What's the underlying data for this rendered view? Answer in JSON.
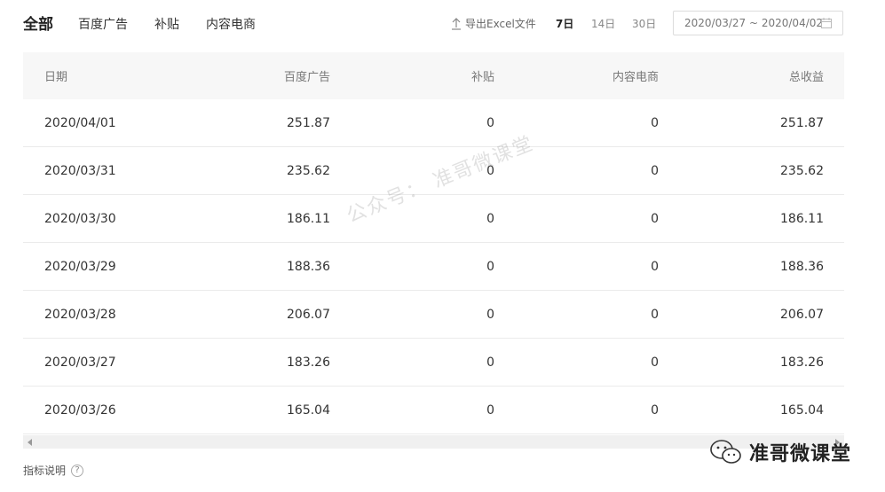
{
  "nav": {
    "all_tab": "全部",
    "tabs": [
      "百度广告",
      "补贴",
      "内容电商"
    ]
  },
  "toolbar": {
    "export_label": "导出Excel文件",
    "periods": [
      "7日",
      "14日",
      "30日"
    ],
    "selected_period": "7日",
    "date_range": "2020/03/27 ~ 2020/04/02"
  },
  "table": {
    "headers": [
      "日期",
      "百度广告",
      "补贴",
      "内容电商",
      "总收益"
    ],
    "rows": [
      [
        "2020/04/01",
        "251.87",
        "0",
        "0",
        "251.87"
      ],
      [
        "2020/03/31",
        "235.62",
        "0",
        "0",
        "235.62"
      ],
      [
        "2020/03/30",
        "186.11",
        "0",
        "0",
        "186.11"
      ],
      [
        "2020/03/29",
        "188.36",
        "0",
        "0",
        "188.36"
      ],
      [
        "2020/03/28",
        "206.07",
        "0",
        "0",
        "206.07"
      ],
      [
        "2020/03/27",
        "183.26",
        "0",
        "0",
        "183.26"
      ],
      [
        "2020/03/26",
        "165.04",
        "0",
        "0",
        "165.04"
      ]
    ]
  },
  "footer": {
    "metric_note": "指标说明",
    "help_glyph": "?"
  },
  "watermarks": {
    "center": "公众号： 准哥微课堂",
    "brand": "准哥微课堂"
  },
  "colors": {
    "header_bg": "#f7f7f7",
    "row_border": "#ebebeb",
    "text": "#333333"
  }
}
